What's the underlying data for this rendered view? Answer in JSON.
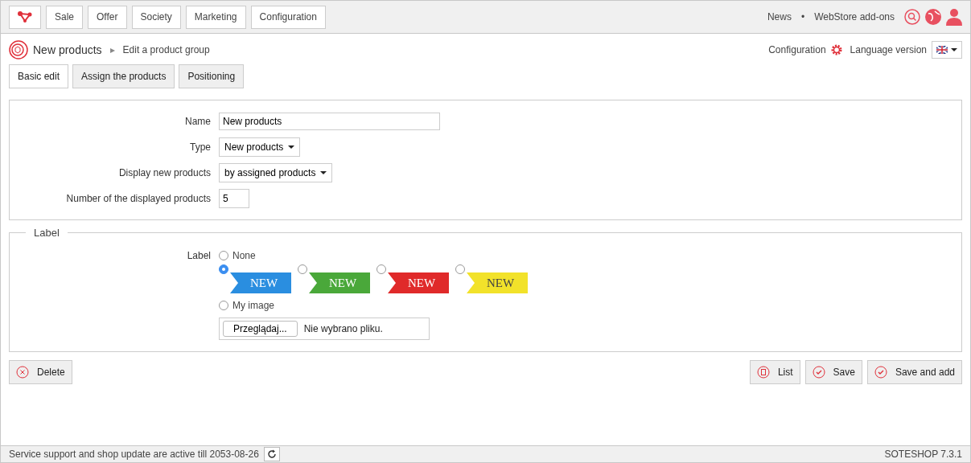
{
  "top_menu": [
    {
      "label": "Sale"
    },
    {
      "label": "Offer"
    },
    {
      "label": "Society"
    },
    {
      "label": "Marketing"
    },
    {
      "label": "Configuration"
    }
  ],
  "top_links": [
    "News",
    "•",
    "WebStore add-ons"
  ],
  "breadcrumb": {
    "title": "New products",
    "separator": "▸",
    "current": "Edit a product group"
  },
  "header_right": {
    "configuration": "Configuration",
    "language_label": "Language version"
  },
  "tabs": [
    {
      "label": "Basic edit",
      "selected": true
    },
    {
      "label": "Assign the products",
      "selected": false
    },
    {
      "label": "Positioning",
      "selected": false
    }
  ],
  "form": [
    {
      "label": "Name",
      "kind": "text",
      "value": "New products"
    },
    {
      "label": "Type",
      "kind": "select",
      "value": "New products"
    },
    {
      "label": "Display new products",
      "kind": "select",
      "value": "by assigned products"
    },
    {
      "label": "Number of the displayed products",
      "kind": "number",
      "value": "5"
    }
  ],
  "label_section": {
    "legend": "Label",
    "field_label": "Label",
    "none": {
      "text": "None",
      "selected": false
    },
    "options": [
      {
        "text": "NEW",
        "color": "#2a8ee0",
        "selected": true
      },
      {
        "text": "NEW",
        "color": "#4aa83a",
        "selected": false
      },
      {
        "text": "NEW",
        "color": "#e02a2a",
        "selected": false
      },
      {
        "text": "NEW",
        "color": "#f2e22a",
        "selected": false
      }
    ],
    "my_image": {
      "text": "My image",
      "selected": false
    },
    "file_button": "Przeglądaj...",
    "file_status": "Nie wybrano pliku."
  },
  "actions_left": [
    {
      "label": "Delete",
      "kind": "delete"
    }
  ],
  "actions_right": [
    {
      "label": "List",
      "kind": "list"
    },
    {
      "label": "Save",
      "kind": "check"
    },
    {
      "label": "Save and add",
      "kind": "check"
    }
  ],
  "status_bar": {
    "text": "Service support and shop update are active till 2053-08-26",
    "version": "SOTESHOP 7.3.1"
  }
}
